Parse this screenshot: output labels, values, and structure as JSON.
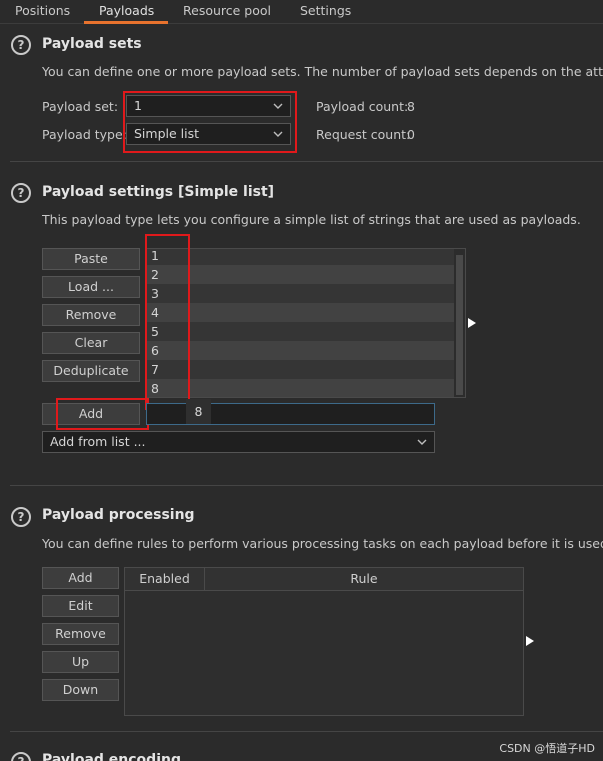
{
  "tabs": [
    {
      "label": "Positions"
    },
    {
      "label": "Payloads"
    },
    {
      "label": "Resource pool"
    },
    {
      "label": "Settings"
    }
  ],
  "payload_sets": {
    "title": "Payload sets",
    "description": "You can define one or more payload sets. The number of payload sets depends on the attack ty",
    "set_label": "Payload set:",
    "set_value": "1",
    "type_label": "Payload type:",
    "type_value": "Simple list",
    "count_label": "Payload count:",
    "count_value": "8",
    "request_label": "Request count:",
    "request_value": "0"
  },
  "payload_settings": {
    "title": "Payload settings [Simple list]",
    "description": "This payload type lets you configure a simple list of strings that are used as payloads.",
    "buttons": {
      "paste": "Paste",
      "load": "Load ...",
      "remove": "Remove",
      "clear": "Clear",
      "deduplicate": "Deduplicate",
      "add": "Add"
    },
    "items": [
      "1",
      "2",
      "3",
      "4",
      "5",
      "6",
      "7",
      "8"
    ],
    "add_input_value": "",
    "tooltip": "8",
    "add_from_list": "Add from list ..."
  },
  "payload_processing": {
    "title": "Payload processing",
    "description": "You can define rules to perform various processing tasks on each payload before it is used.",
    "buttons": {
      "add": "Add",
      "edit": "Edit",
      "remove": "Remove",
      "up": "Up",
      "down": "Down"
    },
    "columns": [
      "Enabled",
      "Rule"
    ]
  },
  "payload_encoding": {
    "title": "Payload encoding"
  },
  "watermark": "CSDN @悟道子HD",
  "colors": {
    "accent": "#e8732e",
    "highlight": "#e0191b",
    "background": "#2b2b2b"
  }
}
